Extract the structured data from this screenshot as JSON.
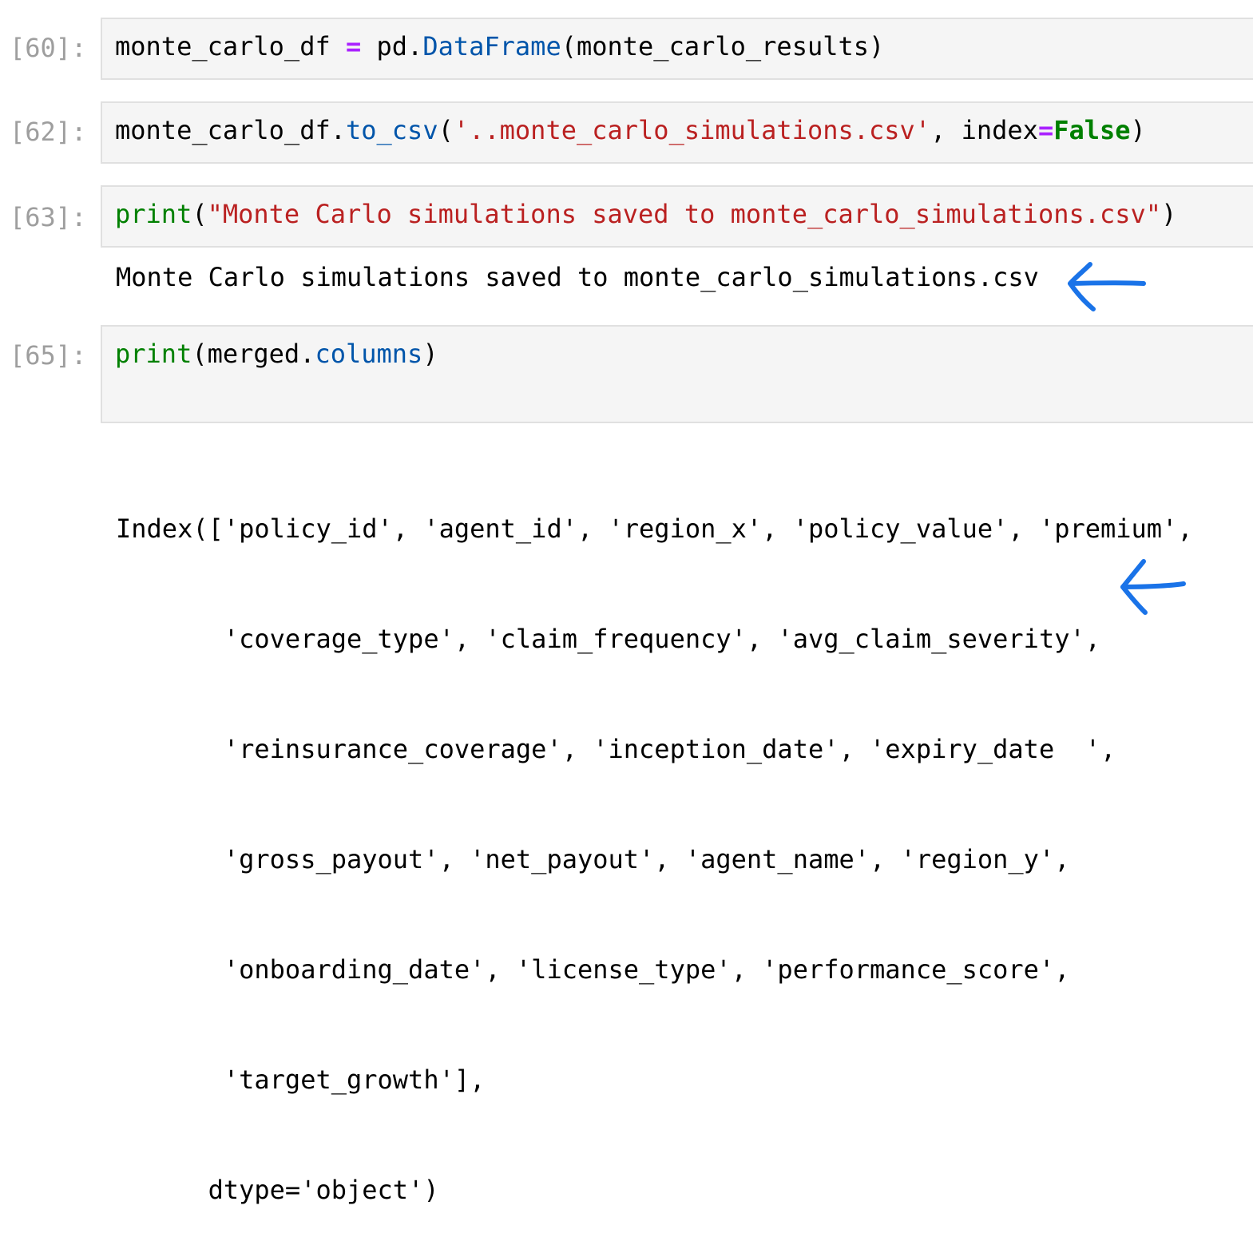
{
  "cells": [
    {
      "prompt": "[60]:",
      "code": {
        "var": "monte_carlo_df ",
        "op": "=",
        "pre": " pd.",
        "attr": "DataFrame",
        "post": "(monte_carlo_results)"
      }
    },
    {
      "prompt": "[62]:",
      "code": {
        "pre": "monte_carlo_df.",
        "attr": "to_csv",
        "open": "(",
        "str": "'..monte_carlo_simulations.csv'",
        "mid": ", index",
        "op": "=",
        "kw": "False",
        "close": ")"
      }
    },
    {
      "prompt": "[63]:",
      "code": {
        "kw": "print",
        "open": "(",
        "str": "\"Monte Carlo simulations saved to monte_carlo_simulations.csv\"",
        "close": ")"
      },
      "output": "Monte Carlo simulations saved to monte_carlo_simulations.csv"
    },
    {
      "prompt": "[65]:",
      "code": {
        "kw": "print",
        "pre": "(merged.",
        "attr": "columns",
        "close": ")"
      },
      "output_lines": [
        "Index(['policy_id', 'agent_id', 'region_x', 'policy_value', 'premium',",
        "       'coverage_type', 'claim_frequency', 'avg_claim_severity',",
        "       'reinsurance_coverage', 'inception_date', 'expiry_date  ',",
        "       'gross_payout', 'net_payout', 'agent_name', 'region_y',",
        "       'onboarding_date', 'license_type', 'performance_score',",
        "       'target_growth'],",
        "      dtype='object')"
      ]
    }
  ],
  "annotations": {
    "arrow_color": "#1a73e8",
    "arrow_1": "blue-hand-drawn-arrow",
    "arrow_2": "blue-hand-drawn-arrow"
  }
}
